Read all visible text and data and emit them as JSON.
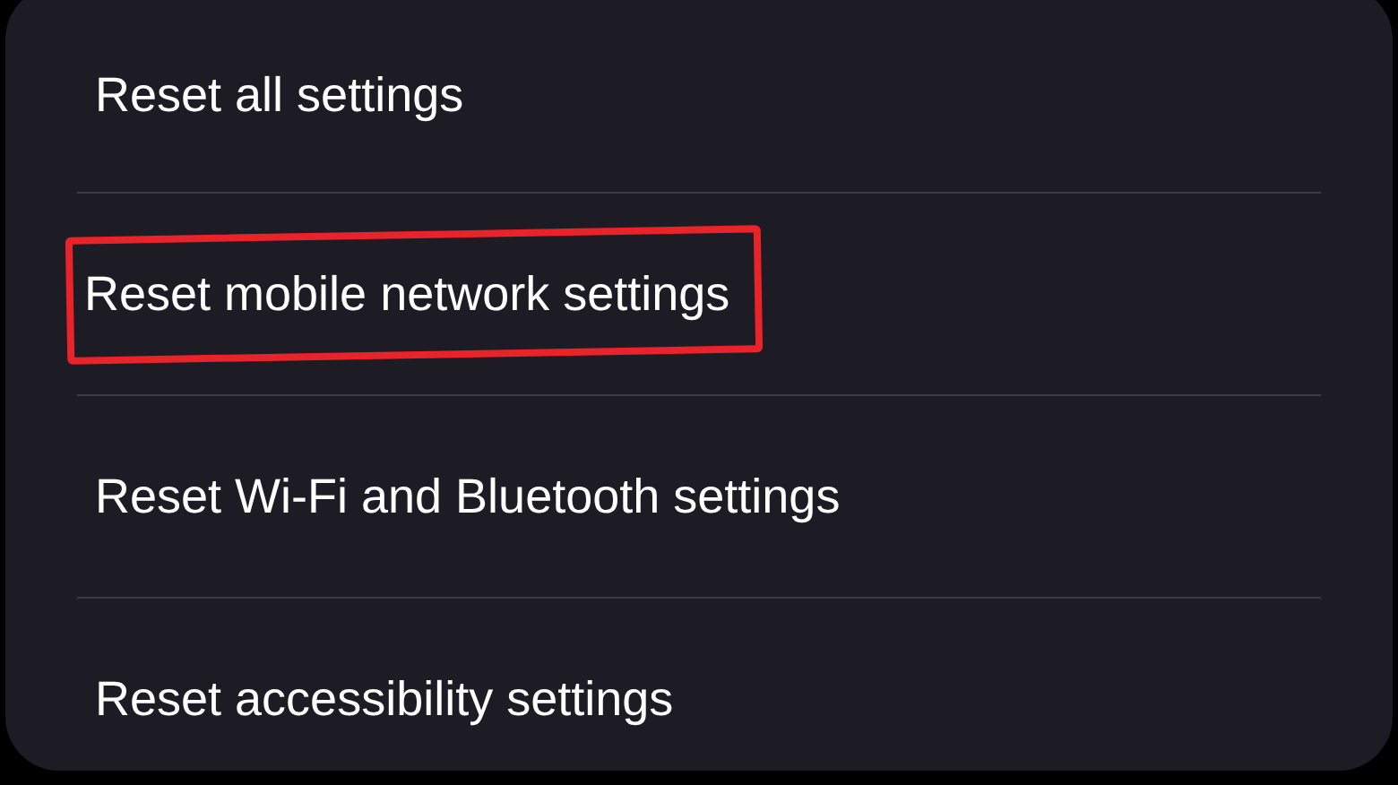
{
  "items": [
    {
      "label": "Reset all settings",
      "highlighted": false
    },
    {
      "label": "Reset mobile network settings",
      "highlighted": true
    },
    {
      "label": "Reset Wi-Fi and Bluetooth settings",
      "highlighted": false
    },
    {
      "label": "Reset accessibility settings",
      "highlighted": false
    }
  ]
}
